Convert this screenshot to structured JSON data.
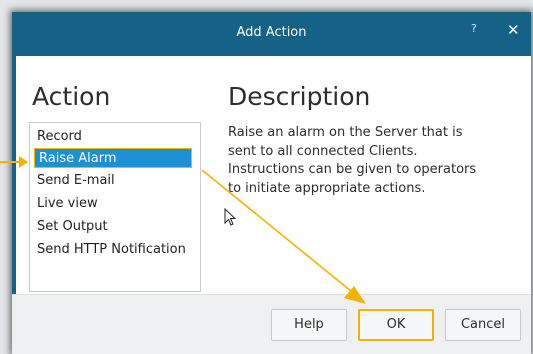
{
  "dialog": {
    "title": "Add Action",
    "help_glyph": "?",
    "close_glyph": "✕"
  },
  "action": {
    "heading": "Action",
    "items": [
      {
        "label": "Record"
      },
      {
        "label": "Raise Alarm",
        "selected": true
      },
      {
        "label": "Send E-mail"
      },
      {
        "label": "Live view"
      },
      {
        "label": "Set Output"
      },
      {
        "label": "Send HTTP Notification"
      }
    ]
  },
  "description": {
    "heading": "Description",
    "lines": [
      "Raise an alarm on the Server that is",
      "sent to all connected Clients.",
      "Instructions can be given to operators",
      "to initiate appropriate actions."
    ]
  },
  "buttons": {
    "help": "Help",
    "ok": "OK",
    "cancel": "Cancel"
  },
  "colors": {
    "titlebar": "#166287",
    "selection": "#1e8fd2",
    "highlight_annotation": "#f3b300"
  }
}
